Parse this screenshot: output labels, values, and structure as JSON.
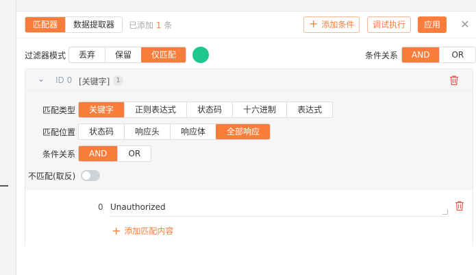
{
  "header": {
    "tabs": [
      {
        "label": "匹配器",
        "active": true
      },
      {
        "label": "数据提取器",
        "active": false
      }
    ],
    "added_prefix": "已添加",
    "added_count": "1",
    "added_suffix": "条",
    "add_condition": "添加条件",
    "debug": "调试执行",
    "apply": "应用",
    "close_icon": "close-icon"
  },
  "filter_mode": {
    "label": "过滤器模式",
    "options": [
      "丢弃",
      "保留",
      "仅匹配"
    ],
    "selected": "仅匹配",
    "indicator_color": "#1ec78f"
  },
  "condition_relation_top": {
    "label": "条件关系",
    "options": [
      "AND",
      "OR"
    ],
    "selected": "AND"
  },
  "card": {
    "id": "ID 0",
    "keyword": "[关键字]",
    "count": "1",
    "match_type": {
      "label": "匹配类型",
      "options": [
        "关键字",
        "正则表达式",
        "状态码",
        "十六进制",
        "表达式"
      ],
      "selected": "关键字"
    },
    "match_position": {
      "label": "匹配位置",
      "options": [
        "状态码",
        "响应头",
        "响应体",
        "全部响应"
      ],
      "selected": "全部响应"
    },
    "condition_relation": {
      "label": "条件关系",
      "options": [
        "AND",
        "OR"
      ],
      "selected": "AND"
    },
    "negate": {
      "label": "不匹配(取反)",
      "enabled": false
    },
    "contents": [
      {
        "index": "0",
        "value": "Unauthorized"
      }
    ],
    "add_content": "添加匹配内容"
  },
  "colors": {
    "accent": "#fa7d3c",
    "indicator": "#1ec78f"
  }
}
